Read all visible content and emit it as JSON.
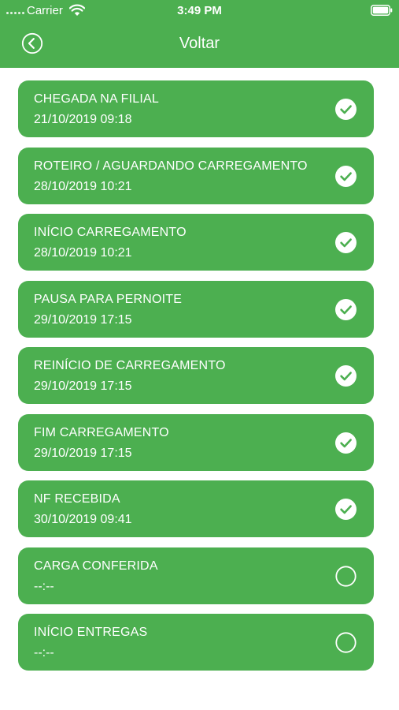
{
  "status_bar": {
    "carrier": "Carrier",
    "time": "3:49 PM"
  },
  "header": {
    "title": "Voltar"
  },
  "colors": {
    "primary": "#4caf50",
    "text_on_primary": "#ffffff"
  },
  "steps": [
    {
      "title": "CHEGADA NA FILIAL",
      "date": "21/10/2019 09:18",
      "done": true
    },
    {
      "title": "ROTEIRO / AGUARDANDO CARREGAMENTO",
      "date": "28/10/2019 10:21",
      "done": true
    },
    {
      "title": "INÍCIO CARREGAMENTO",
      "date": "28/10/2019 10:21",
      "done": true
    },
    {
      "title": "PAUSA PARA PERNOITE",
      "date": "29/10/2019 17:15",
      "done": true
    },
    {
      "title": "REINÍCIO DE CARREGAMENTO",
      "date": "29/10/2019 17:15",
      "done": true
    },
    {
      "title": "FIM CARREGAMENTO",
      "date": "29/10/2019 17:15",
      "done": true
    },
    {
      "title": "NF RECEBIDA",
      "date": "30/10/2019 09:41",
      "done": true
    },
    {
      "title": "CARGA CONFERIDA",
      "date": "--:--",
      "done": false
    },
    {
      "title": "INÍCIO ENTREGAS",
      "date": "--:--",
      "done": false
    }
  ]
}
